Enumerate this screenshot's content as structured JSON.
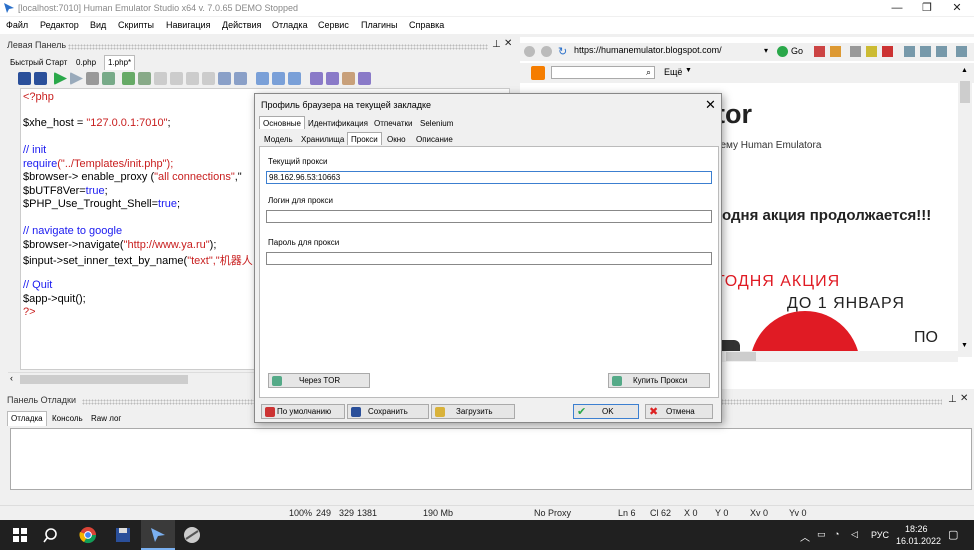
{
  "window": {
    "title": "[localhost:7010] Human Emulator Studio x64 v. 7.0.65 DEMO Stopped",
    "controls": [
      "—",
      "❐",
      "✕"
    ]
  },
  "menu": [
    "Файл",
    "Редактор",
    "Вид",
    "Скрипты",
    "Навигация",
    "Действия",
    "Отладка",
    "Сервис",
    "Плагины",
    "Справка"
  ],
  "left_panel": {
    "title": "Левая Панель",
    "tabs": [
      "Быстрый Старт",
      "0.php",
      "1.php*"
    ],
    "active_tab": 2
  },
  "code_lines": {
    "l1": "<?php",
    "l3a": "$xhe_host = ",
    "l3b": "\"127.0.0.1:7010\"",
    "l3c": ";",
    "l5": "// init",
    "l6a": "require",
    "l6b": "(\"../Templates/init.php\");",
    "l7a": "$browser-> enable_proxy (",
    "l7b": "\"all connections\"",
    "l7c": ",\"",
    "l8a": "$bUTF8Ver=",
    "l8b": "true",
    "l8c": ";",
    "l9a": "$PHP_Use_Trought_Shell=",
    "l9b": "true",
    "l9c": ";",
    "l11": "// navigate to google",
    "l12a": "$browser->",
    "l12b": "navigate(",
    "l12c": "\"http://www.ya.ru\"",
    "l12d": ");",
    "l13a": "$input->",
    "l13b": "set_inner_text_by_name(",
    "l13c": "\"text\",\"机器人",
    "l15": "// Quit",
    "l16a": "$app->",
    "l16b": "quit",
    "l16c": "();",
    "l17": "?>"
  },
  "browser": {
    "url": "https://humanemulator.blogspot.com/",
    "go_label": "Go",
    "more_label": "Ещё",
    "heading_fragment": "tor",
    "sub_fragment": "тему Human Emulatora",
    "promo_fragment": "годня акция продолжается!!!",
    "banner_line1": "ГОДНЯ АКЦИЯ",
    "banner_line2": "ДО 1 ЯНВАРЯ",
    "banner_line3": "ПО"
  },
  "debug_panel": {
    "title": "Панель Отладки",
    "tabs": [
      "Отладка",
      "Консоль",
      "Raw лог"
    ]
  },
  "status": {
    "zoom": "100%",
    "v1": "249",
    "v2": "329",
    "v3": "1381",
    "mem": "190 Mb",
    "proxy": "No Proxy",
    "ln": "Ln 6",
    "cl": "Cl 62",
    "x": "X 0",
    "y": "Y 0",
    "xv": "Xv 0",
    "yv": "Yv 0"
  },
  "taskbar": {
    "lang": "РУС",
    "time": "18:26",
    "date": "16.01.2022"
  },
  "dialog": {
    "title": "Профиль браузера на текущей закладке",
    "tabs_row1": [
      "Основные",
      "Идентификация",
      "Отпечатки",
      "Selenium"
    ],
    "tabs_row2": [
      "Модель",
      "Хранилища",
      "Прокси",
      "Окно",
      "Описание"
    ],
    "current_proxy_label": "Текущий прокси",
    "current_proxy_value": "98.162.96.53:10663",
    "login_label": "Логин для прокси",
    "login_value": "",
    "password_label": "Пароль для прокси",
    "password_value": "",
    "tor_button": "Через TOR",
    "buy_button": "Купить Прокси",
    "default_button": "По умолчанию",
    "save_button": "Сохранить",
    "load_button": "Загрузить",
    "ok_button": "OK",
    "cancel_button": "Отмена"
  },
  "colors": {
    "code_string": "#c81e1e",
    "code_keyword": "#1a1af0",
    "code_comment": "#118811",
    "banner_red": "#e01b24"
  }
}
